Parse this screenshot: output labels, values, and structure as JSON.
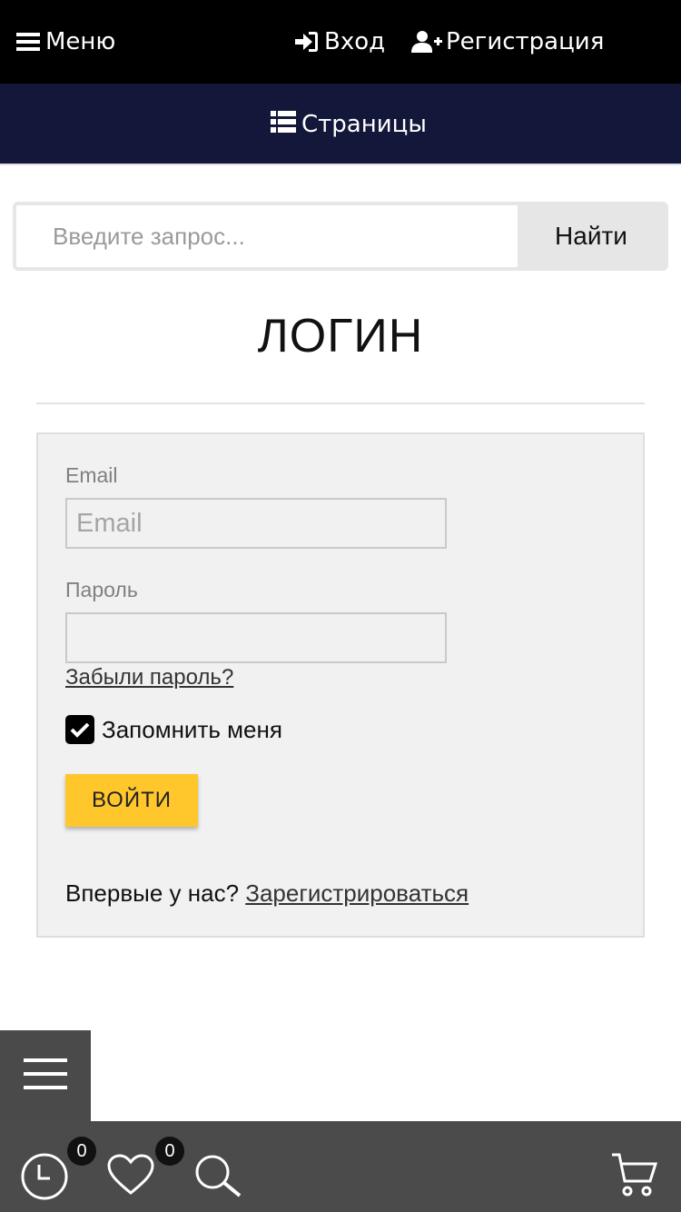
{
  "topbar": {
    "menu_label": "Меню",
    "login_label": "Вход",
    "register_label": "Регистрация"
  },
  "pagesbar": {
    "label": "Страницы"
  },
  "search": {
    "placeholder": "Введите запрос...",
    "button_label": "Найти"
  },
  "page_title": "ЛОГИН",
  "login_form": {
    "email_label": "Email",
    "email_placeholder": "Email",
    "password_label": "Пароль",
    "forgot_link": "Забыли пароль?",
    "remember_label": "Запомнить меня",
    "remember_checked": true,
    "submit_label": "ВОЙТИ",
    "new_user_text": "Впервые у нас?",
    "register_link": "Зарегистрироваться"
  },
  "bottombar": {
    "history_count": "0",
    "wishlist_count": "0"
  },
  "colors": {
    "topbar_bg": "#000000",
    "pagesbar_bg": "#13183b",
    "submit_bg": "#ffc72c",
    "card_bg": "#f1f1f1",
    "bottombar_bg": "#4b4b4b"
  }
}
